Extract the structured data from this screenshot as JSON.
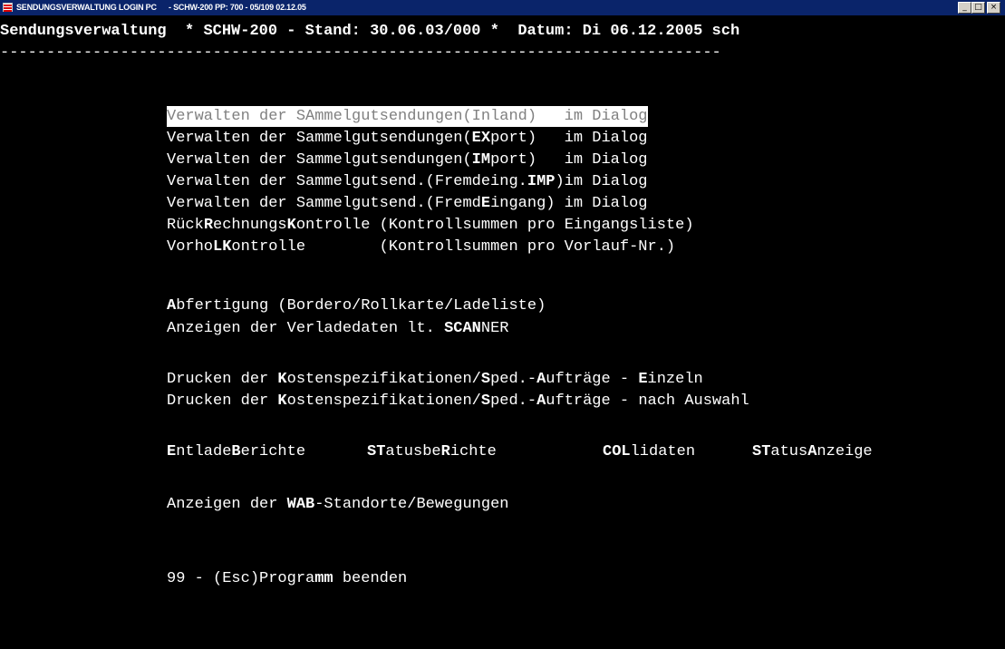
{
  "window": {
    "title_left": "SENDUNGSVERWALTUNG LOGIN PC",
    "title_right": "- SCHW-200 PP: 700 - 05/109 02.12.05",
    "minimize_glyph": "_",
    "maximize_glyph": "□",
    "close_glyph": "×"
  },
  "header": {
    "app": "Sendungsverwaltung",
    "version": "* SCHW-200 - Stand: 30.06.03/000 *",
    "date": "Datum: Di 06.12.2005 sch",
    "separator": "------------------------------------------------------------------------------"
  },
  "menu": {
    "inland": {
      "pre": "Verwalten der ",
      "hot": "SA",
      "post": "mmelgutsendungen(Inland)   im Dialog"
    },
    "export": {
      "pre": "Verwalten der Sammelgutsendungen(",
      "hot": "EX",
      "post": "port)   im Dialog"
    },
    "import": {
      "pre": "Verwalten der Sammelgutsendungen(",
      "hot": "IM",
      "post": "port)   im Dialog"
    },
    "fremd_imp": {
      "pre": "Verwalten der Sammelgutsend.(Fremdeing.",
      "hot": "IMP",
      "post": ")im Dialog"
    },
    "fremd_eingang": {
      "pre": "Verwalten der Sammelgutsend.(Fremd",
      "hot": "E",
      "post": "ingang) im Dialog"
    },
    "rueckrechnung": {
      "pre": "Rück",
      "hot1": "R",
      "mid": "echnungs",
      "hot2": "K",
      "post": "ontrolle (Kontrollsummen pro Eingangsliste)"
    },
    "vorhol": {
      "pre": "Vorho",
      "hot1": "LK",
      "post": "ontrolle        (Kontrollsummen pro Vorlauf-Nr.)"
    },
    "abfertigung": {
      "hot": "A",
      "post": "bfertigung (Bordero/Rollkarte/Ladeliste)"
    },
    "scanner": {
      "pre": "Anzeigen der Verladedaten lt. ",
      "hot": "SCAN",
      "post": "NER"
    },
    "druck_einzeln": {
      "pre1": "Drucken der ",
      "hot1": "K",
      "mid1": "ostenspezifikationen/",
      "hot2": "S",
      "mid2": "ped.-",
      "hot3": "A",
      "mid3": "ufträge - ",
      "hot4": "E",
      "post": "inzeln"
    },
    "druck_auswahl": {
      "pre1": "Drucken der ",
      "hot1": "K",
      "mid1": "ostenspezifikationen/",
      "hot2": "S",
      "mid2": "ped.-",
      "hot3": "A",
      "post": "ufträge - nach Auswahl"
    },
    "row_multi": {
      "e1": "E",
      "e2": "ntlade",
      "e3": "B",
      "e4": "erichte",
      "s1": "ST",
      "s2": "atusbe",
      "s3": "R",
      "s4": "ichte",
      "c1": "COL",
      "c2": "lidaten",
      "a1": "ST",
      "a2": "atus",
      "a3": "A",
      "a4": "nzeige"
    },
    "wab": {
      "pre": "Anzeigen der ",
      "hot": "WAB",
      "post": "-Standorte/Bewegungen"
    },
    "beenden": {
      "pre": "99 - (Esc)Progra",
      "hot": "mm",
      "post": " beenden"
    }
  }
}
